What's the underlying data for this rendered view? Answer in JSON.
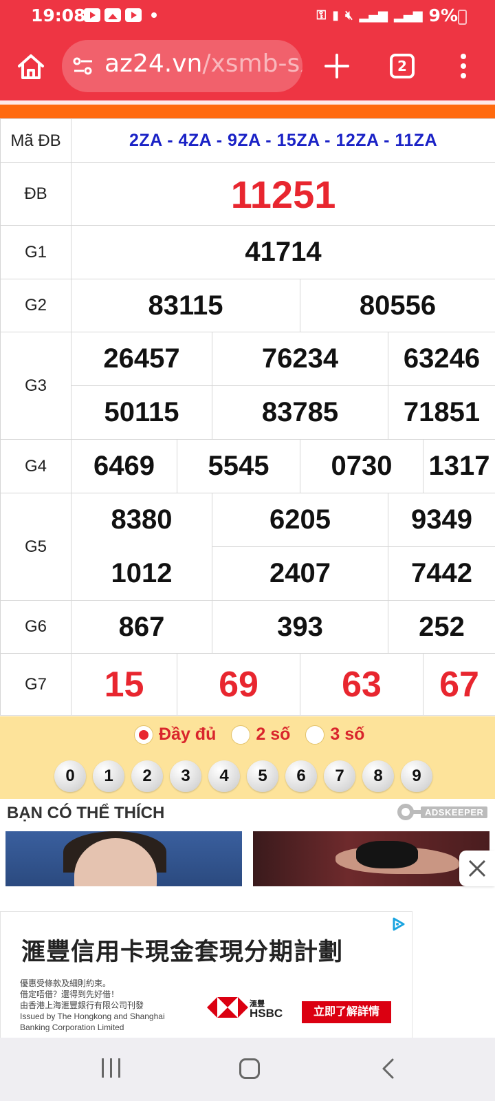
{
  "status_bar": {
    "time": "19:08",
    "battery": "9%",
    "icons": [
      "youtube-icon",
      "gallery-icon",
      "youtube-icon",
      "notification-dot",
      "key-icon",
      "battery-saver-icon",
      "mute-icon",
      "signal-icon",
      "4g-icon",
      "signal-icon",
      "battery-icon"
    ]
  },
  "browser": {
    "url_host": "az24.vn",
    "url_path": "/xsmb-sx",
    "tab_count": "2",
    "accent_color": "#ee3543"
  },
  "results": {
    "ma_db_label": "Mã ĐB",
    "ma_db_value": "2ZA - 4ZA - 9ZA - 15ZA - 12ZA - 11ZA",
    "rows": {
      "db": {
        "label": "ĐB",
        "numbers": [
          "11251"
        ]
      },
      "g1": {
        "label": "G1",
        "numbers": [
          "41714"
        ]
      },
      "g2": {
        "label": "G2",
        "numbers": [
          "83115",
          "80556"
        ]
      },
      "g3": {
        "label": "G3",
        "numbers": [
          "26457",
          "76234",
          "63246",
          "50115",
          "83785",
          "71851"
        ]
      },
      "g4": {
        "label": "G4",
        "numbers": [
          "6469",
          "5545",
          "0730",
          "1317"
        ]
      },
      "g5": {
        "label": "G5",
        "numbers": [
          "8380",
          "6205",
          "9349",
          "1012",
          "2407",
          "7442"
        ]
      },
      "g6": {
        "label": "G6",
        "numbers": [
          "867",
          "393",
          "252"
        ]
      },
      "g7": {
        "label": "G7",
        "numbers": [
          "15",
          "69",
          "63",
          "67"
        ]
      }
    }
  },
  "options": {
    "radios": [
      {
        "label": "Đầy đủ",
        "selected": true
      },
      {
        "label": "2 số",
        "selected": false
      },
      {
        "label": "3 số",
        "selected": false
      }
    ],
    "digits": [
      "0",
      "1",
      "2",
      "3",
      "4",
      "5",
      "6",
      "7",
      "8",
      "9"
    ]
  },
  "recommendations": {
    "title": "BẠN CÓ THỂ THÍCH",
    "provider": "ADSKEEPER"
  },
  "ad": {
    "headline": "滙豐信用卡現金套現分期計劃",
    "fine_print": [
      "優惠受條款及細則約束。",
      "借定唔借？還得到先好借！",
      "由香港上海滙豐銀行有限公司刊發",
      "Issued by The Hongkong and Shanghai",
      "Banking Corporation Limited"
    ],
    "brand_cn": "滙豐",
    "brand": "HSBC",
    "cta": "立即了解詳情",
    "brand_color": "#db0011"
  }
}
